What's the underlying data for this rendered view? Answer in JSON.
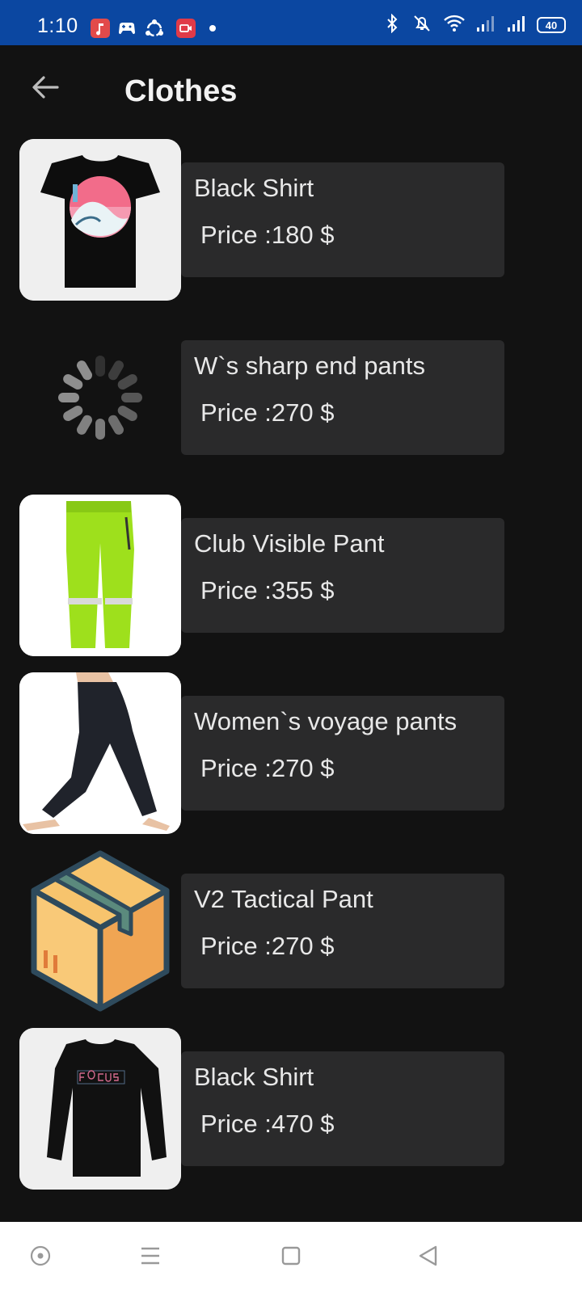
{
  "status_bar": {
    "time": "1:10",
    "battery": "40",
    "notification_icons": [
      "music-app-icon",
      "game-controller-icon",
      "sync-app-icon",
      "video-app-icon"
    ],
    "system_icons": [
      "bluetooth-icon",
      "vibrate-off-icon",
      "wifi-icon",
      "signal-1-icon",
      "signal-2-icon",
      "battery-icon"
    ],
    "color": "#0b47a1"
  },
  "app_bar": {
    "title": "Clothes",
    "back_icon": "arrow-back-icon"
  },
  "items": [
    {
      "name": "Black Shirt",
      "price": "Price :180 $",
      "image": "black-wave-tshirt"
    },
    {
      "name": "W`s sharp end pants",
      "price": "Price :270 $",
      "image": "loading-spinner"
    },
    {
      "name": "Club Visible Pant",
      "price": "Price :355 $",
      "image": "green-reflective-pants"
    },
    {
      "name": "Women`s voyage pants",
      "price": "Price :270 $",
      "image": "black-voyage-pants"
    },
    {
      "name": "V2 Tactical Pant",
      "price": "Price :270 $",
      "image": "cardboard-box-placeholder"
    },
    {
      "name": "Black Shirt",
      "price": "Price :470 $",
      "image": "black-focus-longsleeve"
    }
  ],
  "nav_bar": {
    "buttons": [
      "dot-circle-icon",
      "menu-icon",
      "home-square-icon",
      "back-triangle-icon"
    ]
  },
  "colors": {
    "background": "#121212",
    "card": "#2a2a2b",
    "text": "#e8e8e8"
  }
}
